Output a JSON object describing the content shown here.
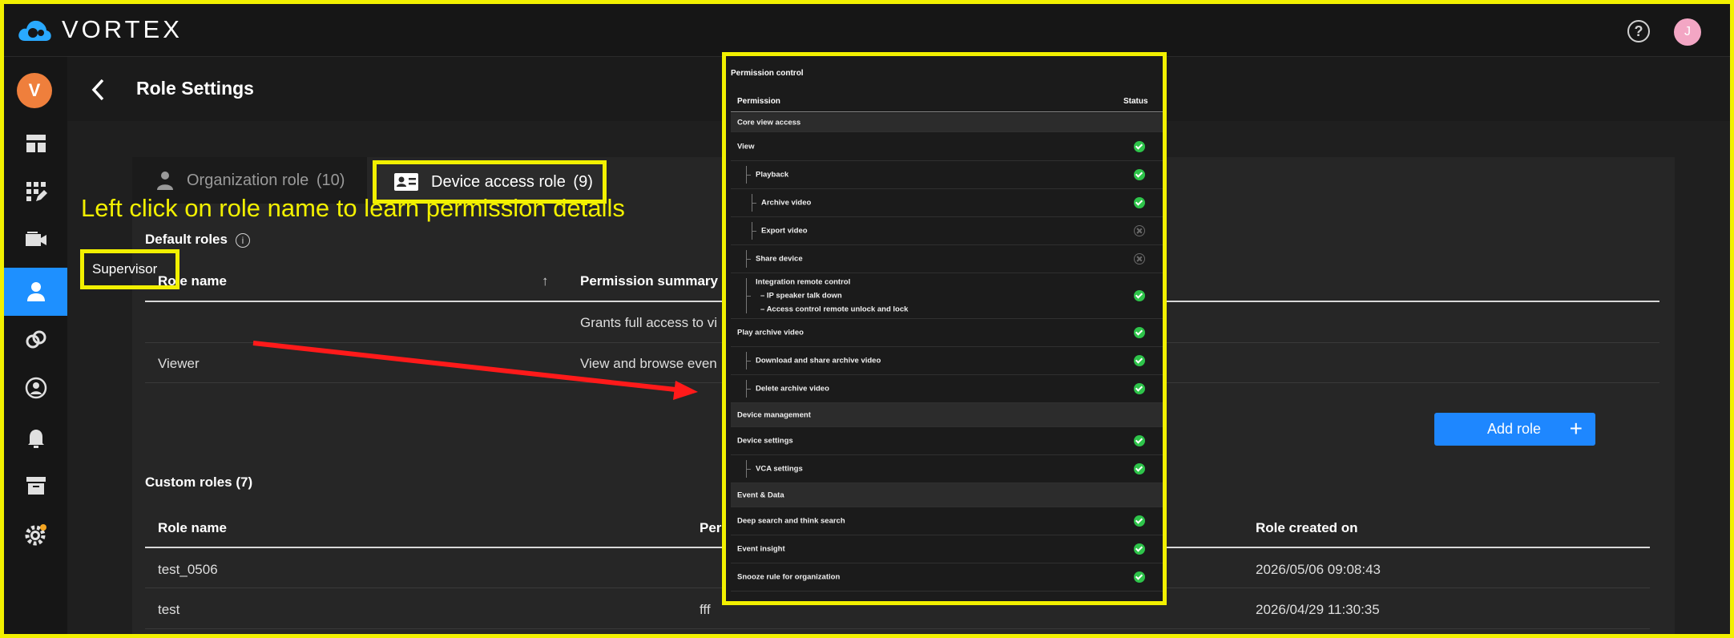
{
  "app": {
    "brand": "VORTEX",
    "user_initial": "J",
    "help_symbol": "?"
  },
  "sidebar": {
    "user_initial": "V",
    "items": [
      {
        "icon": "layout-dashboard-icon"
      },
      {
        "icon": "apps-edit-icon"
      },
      {
        "icon": "camera-icon"
      },
      {
        "icon": "user-icon",
        "active": true
      },
      {
        "icon": "link-icon"
      },
      {
        "icon": "user-circle-icon"
      },
      {
        "icon": "bell-icon"
      },
      {
        "icon": "archive-icon"
      },
      {
        "icon": "settings-icon"
      }
    ]
  },
  "page": {
    "title": "Role Settings"
  },
  "tabs": {
    "org": {
      "label": "Organization role",
      "count": "(10)"
    },
    "device": {
      "label": "Device access role",
      "count": "(9)"
    }
  },
  "default_roles": {
    "title": "Default roles",
    "hint": "Left click on role name to learn permission details",
    "col_name": "Role name",
    "col_summary": "Permission summary",
    "rows": [
      {
        "name": "Supervisor",
        "summary": "Grants full access to vi"
      },
      {
        "name": "Viewer",
        "summary": "View and browse even"
      }
    ]
  },
  "custom_roles": {
    "title": "Custom roles (7)",
    "add_label": "Add role",
    "col_name": "Role name",
    "col_perm": "Per",
    "col_created": "Role created on",
    "rows": [
      {
        "name": "test_0506",
        "perm": "",
        "created": "2026/05/06 09:08:43"
      },
      {
        "name": "test",
        "perm": "fff",
        "created": "2026/04/29 11:30:35"
      }
    ]
  },
  "permission_control": {
    "title": "Permission control",
    "col_permission": "Permission",
    "col_status": "Status",
    "rows": [
      {
        "label": "Core view access",
        "group": true
      },
      {
        "label": "View",
        "status": "allowed"
      },
      {
        "label": "Playback",
        "status": "allowed"
      },
      {
        "label": "Archive video",
        "status": "allowed"
      },
      {
        "label": "Export video",
        "status": "denied"
      },
      {
        "label": "Share device",
        "status": "denied"
      },
      {
        "label": "Integration remote control",
        "line2": "– IP speaker talk down",
        "line3": "– Access control remote unlock and lock",
        "status": "allowed"
      },
      {
        "label": "Play archive video",
        "status": "allowed"
      },
      {
        "label": "Download and share archive video",
        "status": "allowed"
      },
      {
        "label": "Delete archive video",
        "status": "allowed"
      },
      {
        "label": "Device management",
        "group": true
      },
      {
        "label": "Device settings",
        "status": "allowed"
      },
      {
        "label": "VCA settings",
        "status": "allowed"
      },
      {
        "label": "Event & Data",
        "group": true
      },
      {
        "label": "Deep search and think search",
        "status": "allowed"
      },
      {
        "label": "Event insight",
        "status": "allowed"
      },
      {
        "label": "Snooze rule for organization",
        "status": "allowed"
      }
    ]
  },
  "colors": {
    "accent": "#1e87ff",
    "highlight": "#f2f000",
    "ok": "#2ec44a",
    "annotation_arrow": "#ff1a1a"
  }
}
